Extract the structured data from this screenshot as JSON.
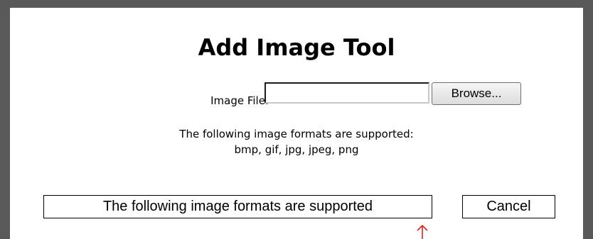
{
  "dialog": {
    "title": "Add Image Tool",
    "file_label": "Image File:",
    "file_input_value": "",
    "browse_label": "Browse...",
    "formats_heading": "The following image formats are supported:",
    "formats_list": "bmp, gif, jpg, jpeg, png",
    "tooltip_text": "The following image formats are supported",
    "cancel_label": "Cancel"
  },
  "annotation": {
    "arrow_icon": "up-arrow-icon",
    "arrow_color": "#e2231a"
  },
  "colors": {
    "frame": "#595959",
    "dialog_background": "#ffffff"
  }
}
